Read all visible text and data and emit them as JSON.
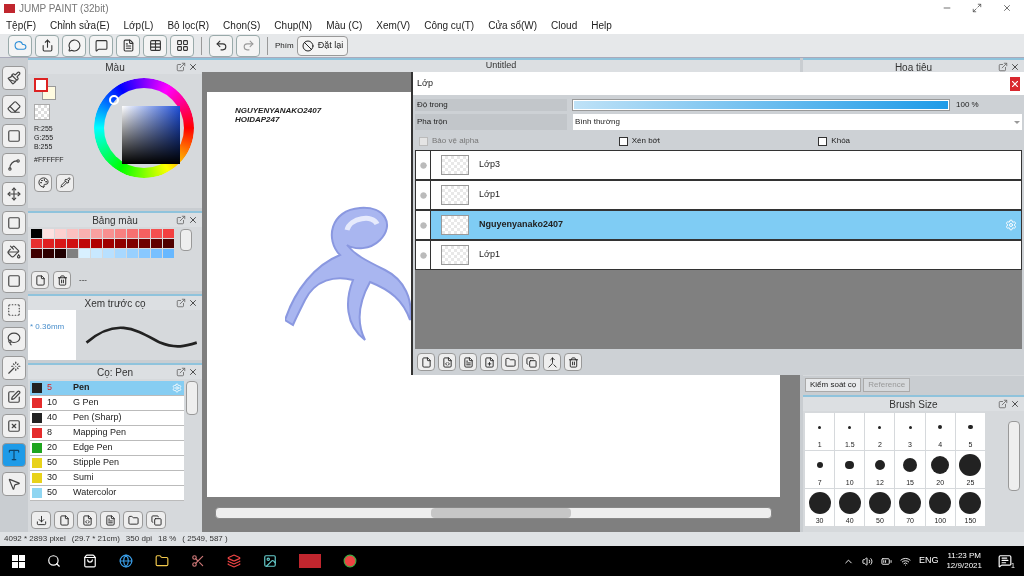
{
  "window": {
    "title": "JUMP PAINT (32bit)"
  },
  "menu": [
    "Tệp(F)",
    "Chỉnh sửa(E)",
    "Lớp(L)",
    "Bộ lọc(R)",
    "Chọn(S)",
    "Chụp(N)",
    "Màu (C)",
    "Xem(V)",
    "Công cụ(T)",
    "Cửa sổ(W)",
    "Cloud",
    "Help"
  ],
  "toolbar": {
    "key_label": "Phím",
    "reset_button": "Đặt lại"
  },
  "color_panel": {
    "title": "Màu",
    "r": "R:255",
    "g": "G:255",
    "b": "B:255",
    "hex": "#FFFFFF"
  },
  "palette_panel": {
    "title": "Bảng màu",
    "label": "---"
  },
  "brush_preview": {
    "title": "Xem trước cọ",
    "size": "* 0.36mm"
  },
  "brush_list": {
    "title": "Cọ: Pen",
    "items": [
      {
        "size": "5",
        "name": "Pen",
        "color": "#222222",
        "selected": true
      },
      {
        "size": "10",
        "name": "G Pen",
        "color": "#e52b2b",
        "selected": false
      },
      {
        "size": "40",
        "name": "Pen (Sharp)",
        "color": "#222222",
        "selected": false
      },
      {
        "size": "8",
        "name": "Mapping Pen",
        "color": "#e52b2b",
        "selected": false
      },
      {
        "size": "20",
        "name": "Edge Pen",
        "color": "#1fa51f",
        "selected": false
      },
      {
        "size": "50",
        "name": "Stipple Pen",
        "color": "#e8d21a",
        "selected": false
      },
      {
        "size": "30",
        "name": "Sumi",
        "color": "#e8d21a",
        "selected": false
      },
      {
        "size": "50",
        "name": "Watercolor",
        "color": "#8fd6f2",
        "selected": false
      }
    ]
  },
  "canvas": {
    "tab": "Untitled",
    "text": [
      "NGUYENYANAKO2407",
      "HOIDAP247"
    ]
  },
  "navigator": {
    "title": "Hoa tiêu"
  },
  "layers": {
    "title": "Lớp",
    "opacity_label": "Độ trong",
    "level": 1.0,
    "reading": "100 %",
    "blend_label": "Pha trộn",
    "blend_value": "Bình thường",
    "options": [
      {
        "label": "Bảo vệ alpha",
        "checked": false,
        "disabled": true
      },
      {
        "label": "Xén bớt",
        "checked": false,
        "disabled": false
      },
      {
        "label": "Khóa",
        "checked": false,
        "disabled": false
      }
    ],
    "items": [
      {
        "name": "Lớp3",
        "selected": false
      },
      {
        "name": "Lớp1",
        "selected": false
      },
      {
        "name": "Nguyenyanako2407",
        "selected": true
      },
      {
        "name": "Lớp1",
        "selected": false
      }
    ]
  },
  "brush_tabs": [
    {
      "label": "Kiểm soát cọ",
      "selected": true
    },
    {
      "label": "Reference",
      "selected": false
    }
  ],
  "brush_size": {
    "title": "Brush Size",
    "sizes": [
      "1",
      "1.5",
      "2",
      "3",
      "4",
      "5",
      "7",
      "10",
      "12",
      "15",
      "20",
      "25",
      "30",
      "40",
      "50",
      "70",
      "100",
      "150"
    ]
  },
  "status_bar": [
    "4092 * 2893 pixel",
    "(29.7 * 21cm)",
    "350 dpi",
    "18 %",
    "( 2549, 587 )"
  ],
  "taskbar": {
    "language": "ENG",
    "time": "11:23 PM",
    "date": "12/9/2021",
    "notifications": "1"
  }
}
